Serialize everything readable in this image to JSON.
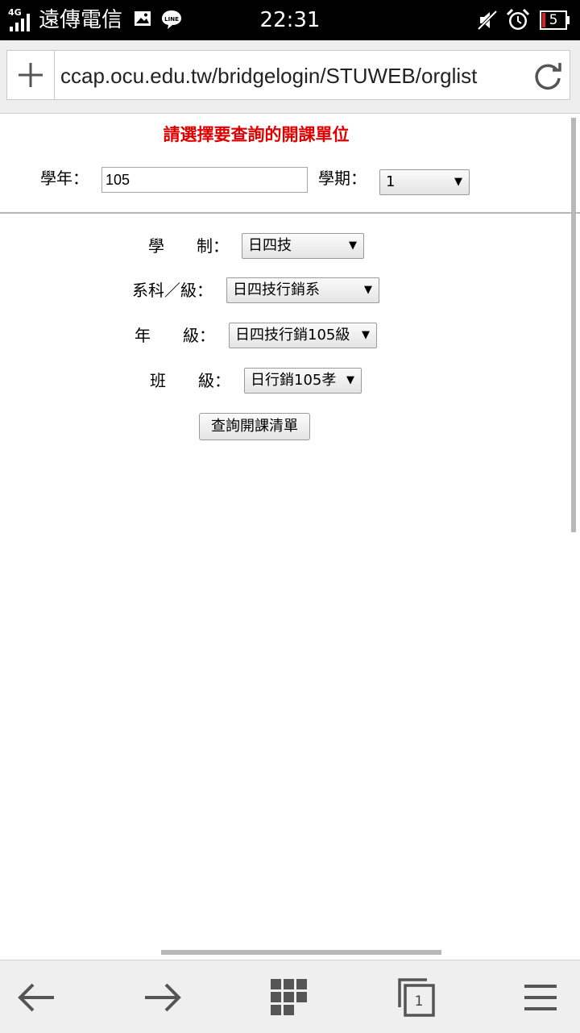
{
  "status_bar": {
    "network": "4G",
    "carrier": "遠傳電信",
    "time": "22:31",
    "battery": "5",
    "icons": [
      "signal-icon",
      "image-notification-icon",
      "line-app-icon",
      "mute-icon",
      "alarm-icon",
      "battery-icon"
    ]
  },
  "browser": {
    "url": "ccap.ocu.edu.tw/bridgelogin/STUWEB/orglist",
    "tab_count": "1",
    "icons": [
      "plus-icon",
      "reload-icon",
      "back-arrow-icon",
      "forward-arrow-icon",
      "grid-icon",
      "tabs-icon",
      "menu-icon"
    ]
  },
  "page": {
    "title": "請選擇要查詢的開課單位",
    "year_label": "學年：",
    "year_value": "105",
    "semester_label": "學期：",
    "semester_value": "1",
    "system_label": "學　　制：",
    "system_value": "日四技",
    "dept_label": "系科／級：",
    "dept_value": "日四技行銷系",
    "grade_label": "年　　級：",
    "grade_value": "日四技行銷105級",
    "class_label": "班　　級：",
    "class_value": "日行銷105孝",
    "query_button": "查詢開課清單"
  },
  "colors": {
    "title": "#e00000",
    "status_bar_bg": "#000000",
    "toolbar_bg": "#eeeeee"
  }
}
